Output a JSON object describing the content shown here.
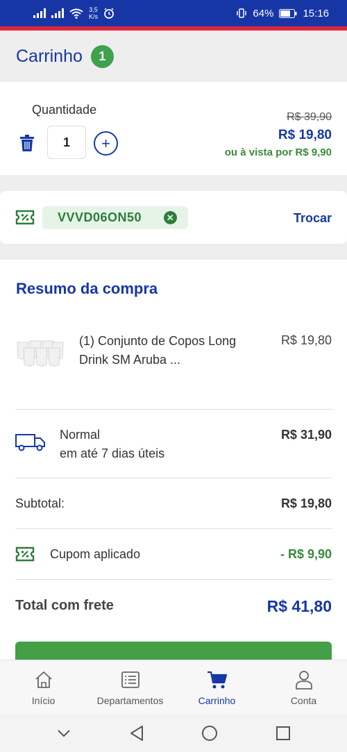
{
  "status_bar": {
    "net_speed_value": "3,5",
    "net_speed_unit": "K/s",
    "battery": "64%",
    "time": "15:16"
  },
  "header": {
    "title": "Carrinho",
    "count": "1"
  },
  "cart_item": {
    "quantity_label": "Quantidade",
    "quantity": "1",
    "old_price": "R$ 39,90",
    "price": "R$ 19,80",
    "cash_price": "ou à vista por R$ 9,90"
  },
  "coupon": {
    "code": "VVVD06ON50",
    "change_label": "Trocar"
  },
  "summary": {
    "title": "Resumo da compra",
    "product": {
      "name": "(1) Conjunto de Copos Long Drink SM Aruba ...",
      "price": "R$ 19,80"
    },
    "shipping": {
      "name": "Normal",
      "time": "em até 7 dias úteis",
      "price": "R$ 31,90"
    },
    "subtotal_label": "Subtotal:",
    "subtotal_value": "R$ 19,80",
    "coupon_label": "Cupom aplicado",
    "coupon_value": "- R$ 9,90",
    "total_label": "Total com frete",
    "total_value": "R$ 41,80"
  },
  "bottom_nav": {
    "items": [
      {
        "label": "Início",
        "icon": "home-icon"
      },
      {
        "label": "Departamentos",
        "icon": "list-icon"
      },
      {
        "label": "Carrinho",
        "icon": "cart-icon",
        "active": true
      },
      {
        "label": "Conta",
        "icon": "user-icon"
      }
    ]
  },
  "colors": {
    "brand_blue": "#1537a8",
    "status_bar": "#1736a6",
    "accent_red": "#e0263a",
    "success_green": "#3fa14e"
  }
}
